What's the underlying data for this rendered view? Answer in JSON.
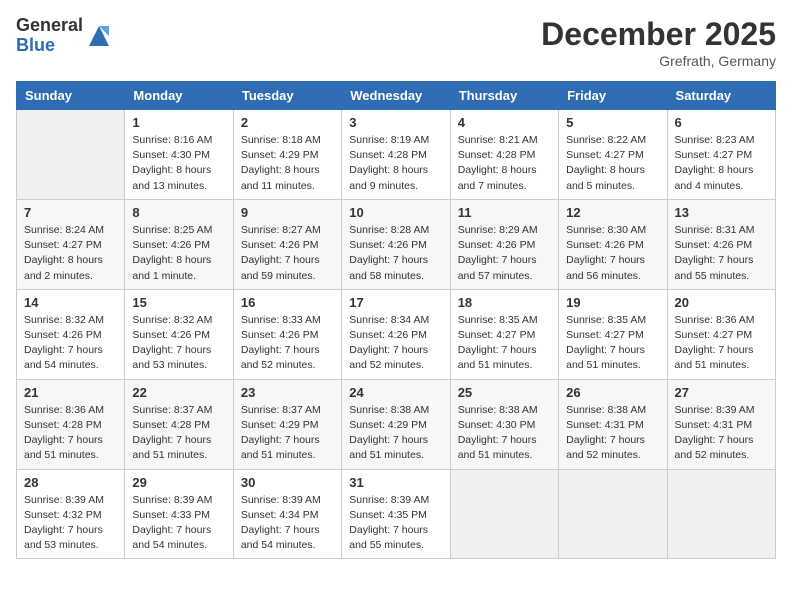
{
  "logo": {
    "general": "General",
    "blue": "Blue"
  },
  "header": {
    "title": "December 2025",
    "location": "Grefrath, Germany"
  },
  "weekdays": [
    "Sunday",
    "Monday",
    "Tuesday",
    "Wednesday",
    "Thursday",
    "Friday",
    "Saturday"
  ],
  "weeks": [
    [
      {
        "day": "",
        "info": ""
      },
      {
        "day": "1",
        "info": "Sunrise: 8:16 AM\nSunset: 4:30 PM\nDaylight: 8 hours\nand 13 minutes."
      },
      {
        "day": "2",
        "info": "Sunrise: 8:18 AM\nSunset: 4:29 PM\nDaylight: 8 hours\nand 11 minutes."
      },
      {
        "day": "3",
        "info": "Sunrise: 8:19 AM\nSunset: 4:28 PM\nDaylight: 8 hours\nand 9 minutes."
      },
      {
        "day": "4",
        "info": "Sunrise: 8:21 AM\nSunset: 4:28 PM\nDaylight: 8 hours\nand 7 minutes."
      },
      {
        "day": "5",
        "info": "Sunrise: 8:22 AM\nSunset: 4:27 PM\nDaylight: 8 hours\nand 5 minutes."
      },
      {
        "day": "6",
        "info": "Sunrise: 8:23 AM\nSunset: 4:27 PM\nDaylight: 8 hours\nand 4 minutes."
      }
    ],
    [
      {
        "day": "7",
        "info": "Sunrise: 8:24 AM\nSunset: 4:27 PM\nDaylight: 8 hours\nand 2 minutes."
      },
      {
        "day": "8",
        "info": "Sunrise: 8:25 AM\nSunset: 4:26 PM\nDaylight: 8 hours\nand 1 minute."
      },
      {
        "day": "9",
        "info": "Sunrise: 8:27 AM\nSunset: 4:26 PM\nDaylight: 7 hours\nand 59 minutes."
      },
      {
        "day": "10",
        "info": "Sunrise: 8:28 AM\nSunset: 4:26 PM\nDaylight: 7 hours\nand 58 minutes."
      },
      {
        "day": "11",
        "info": "Sunrise: 8:29 AM\nSunset: 4:26 PM\nDaylight: 7 hours\nand 57 minutes."
      },
      {
        "day": "12",
        "info": "Sunrise: 8:30 AM\nSunset: 4:26 PM\nDaylight: 7 hours\nand 56 minutes."
      },
      {
        "day": "13",
        "info": "Sunrise: 8:31 AM\nSunset: 4:26 PM\nDaylight: 7 hours\nand 55 minutes."
      }
    ],
    [
      {
        "day": "14",
        "info": "Sunrise: 8:32 AM\nSunset: 4:26 PM\nDaylight: 7 hours\nand 54 minutes."
      },
      {
        "day": "15",
        "info": "Sunrise: 8:32 AM\nSunset: 4:26 PM\nDaylight: 7 hours\nand 53 minutes."
      },
      {
        "day": "16",
        "info": "Sunrise: 8:33 AM\nSunset: 4:26 PM\nDaylight: 7 hours\nand 52 minutes."
      },
      {
        "day": "17",
        "info": "Sunrise: 8:34 AM\nSunset: 4:26 PM\nDaylight: 7 hours\nand 52 minutes."
      },
      {
        "day": "18",
        "info": "Sunrise: 8:35 AM\nSunset: 4:27 PM\nDaylight: 7 hours\nand 51 minutes."
      },
      {
        "day": "19",
        "info": "Sunrise: 8:35 AM\nSunset: 4:27 PM\nDaylight: 7 hours\nand 51 minutes."
      },
      {
        "day": "20",
        "info": "Sunrise: 8:36 AM\nSunset: 4:27 PM\nDaylight: 7 hours\nand 51 minutes."
      }
    ],
    [
      {
        "day": "21",
        "info": "Sunrise: 8:36 AM\nSunset: 4:28 PM\nDaylight: 7 hours\nand 51 minutes."
      },
      {
        "day": "22",
        "info": "Sunrise: 8:37 AM\nSunset: 4:28 PM\nDaylight: 7 hours\nand 51 minutes."
      },
      {
        "day": "23",
        "info": "Sunrise: 8:37 AM\nSunset: 4:29 PM\nDaylight: 7 hours\nand 51 minutes."
      },
      {
        "day": "24",
        "info": "Sunrise: 8:38 AM\nSunset: 4:29 PM\nDaylight: 7 hours\nand 51 minutes."
      },
      {
        "day": "25",
        "info": "Sunrise: 8:38 AM\nSunset: 4:30 PM\nDaylight: 7 hours\nand 51 minutes."
      },
      {
        "day": "26",
        "info": "Sunrise: 8:38 AM\nSunset: 4:31 PM\nDaylight: 7 hours\nand 52 minutes."
      },
      {
        "day": "27",
        "info": "Sunrise: 8:39 AM\nSunset: 4:31 PM\nDaylight: 7 hours\nand 52 minutes."
      }
    ],
    [
      {
        "day": "28",
        "info": "Sunrise: 8:39 AM\nSunset: 4:32 PM\nDaylight: 7 hours\nand 53 minutes."
      },
      {
        "day": "29",
        "info": "Sunrise: 8:39 AM\nSunset: 4:33 PM\nDaylight: 7 hours\nand 54 minutes."
      },
      {
        "day": "30",
        "info": "Sunrise: 8:39 AM\nSunset: 4:34 PM\nDaylight: 7 hours\nand 54 minutes."
      },
      {
        "day": "31",
        "info": "Sunrise: 8:39 AM\nSunset: 4:35 PM\nDaylight: 7 hours\nand 55 minutes."
      },
      {
        "day": "",
        "info": ""
      },
      {
        "day": "",
        "info": ""
      },
      {
        "day": "",
        "info": ""
      }
    ]
  ]
}
